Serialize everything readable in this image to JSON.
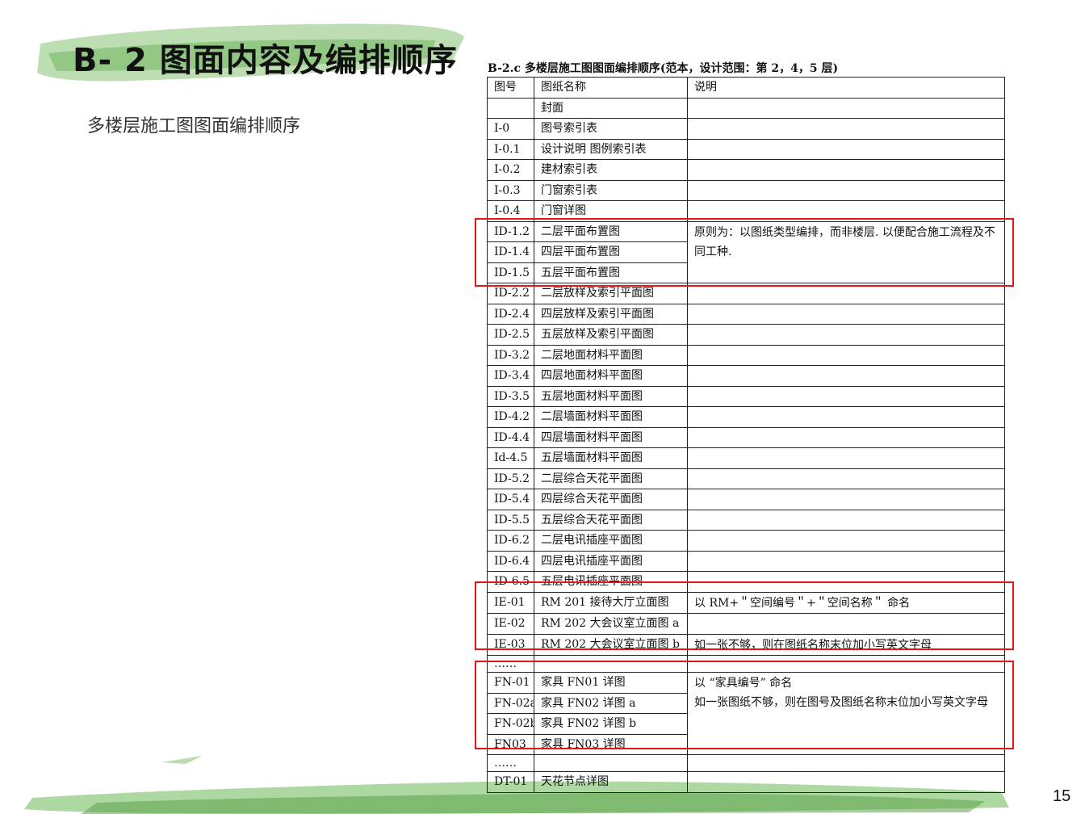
{
  "slide": {
    "title": "B- 2 图面内容及编排顺序",
    "subtitle": "多楼层施工图图面编排顺序",
    "page_number": "15"
  },
  "table": {
    "caption": "B-2.c  多楼层施工图图面编排顺序(范本，设计范围：第 2，4，5 层)",
    "headers": [
      "图号",
      "图纸名称",
      "说明"
    ],
    "rows": [
      {
        "code": "",
        "name": "封面"
      },
      {
        "code": "I-0",
        "name": "图号索引表"
      },
      {
        "code": "I-0.1",
        "name": "设计说明  图例索引表"
      },
      {
        "code": "I-0.2",
        "name": "建材索引表"
      },
      {
        "code": "I-0.3",
        "name": "门窗索引表"
      },
      {
        "code": "I-0.4",
        "name": "门窗详图"
      },
      {
        "code": "ID-1.2",
        "name": "二层平面布置图"
      },
      {
        "code": "ID-1.4",
        "name": "四层平面布置图"
      },
      {
        "code": "ID-1.5",
        "name": "五层平面布置图"
      },
      {
        "code": "ID-2.2",
        "name": "二层放样及索引平面图"
      },
      {
        "code": "ID-2.4",
        "name": "四层放样及索引平面图"
      },
      {
        "code": "ID-2.5",
        "name": "五层放样及索引平面图"
      },
      {
        "code": "ID-3.2",
        "name": "二层地面材料平面图"
      },
      {
        "code": "ID-3.4",
        "name": "四层地面材料平面图"
      },
      {
        "code": "ID-3.5",
        "name": "五层地面材料平面图"
      },
      {
        "code": "ID-4.2",
        "name": "二层墙面材料平面图"
      },
      {
        "code": "ID-4.4",
        "name": "四层墙面材料平面图"
      },
      {
        "code": "Id-4.5",
        "name": "五层墙面材料平面图"
      },
      {
        "code": "ID-5.2",
        "name": "二层综合天花平面图"
      },
      {
        "code": "ID-5.4",
        "name": "四层综合天花平面图"
      },
      {
        "code": "ID-5.5",
        "name": "五层综合天花平面图"
      },
      {
        "code": "ID-6.2",
        "name": "二层电讯插座平面图"
      },
      {
        "code": "ID-6.4",
        "name": "四层电讯插座平面图"
      },
      {
        "code": "ID-6.5",
        "name": "五层电讯插座平面图"
      },
      {
        "code": "IE-01",
        "name": "RM 201 接待大厅立面图"
      },
      {
        "code": "IE-02",
        "name": "RM 202 大会议室立面图 a"
      },
      {
        "code": "IE-03",
        "name": "RM 202 大会议室立面图 b"
      },
      {
        "code": "……",
        "name": ""
      },
      {
        "code": "FN-01",
        "name": "家具 FN01 详图"
      },
      {
        "code": "FN-02a",
        "name": "家具 FN02 详图 a"
      },
      {
        "code": "FN-02b",
        "name": "家具 FN02 详图 b"
      },
      {
        "code": "FN03",
        "name": "家具 FN03 详图"
      },
      {
        "code": "……",
        "name": ""
      },
      {
        "code": "DT-01",
        "name": "天花节点详图"
      }
    ],
    "notes": {
      "floor_plans": "原则为：以图纸类型编排，而非楼层. 以便配合施工流程及不同工种.",
      "ie_01": "以 RM+＂空间编号＂+＂空间名称＂ 命名",
      "ie_03": "如一张不够，则在图纸名称末位加小写英文字母",
      "furniture": "以 “家具编号” 命名\n如一张图纸不够，则在图号及图纸名称末位加小写英文字母"
    }
  },
  "colors": {
    "highlight": "#e0181c",
    "brush_green": "#7fbf6a"
  }
}
